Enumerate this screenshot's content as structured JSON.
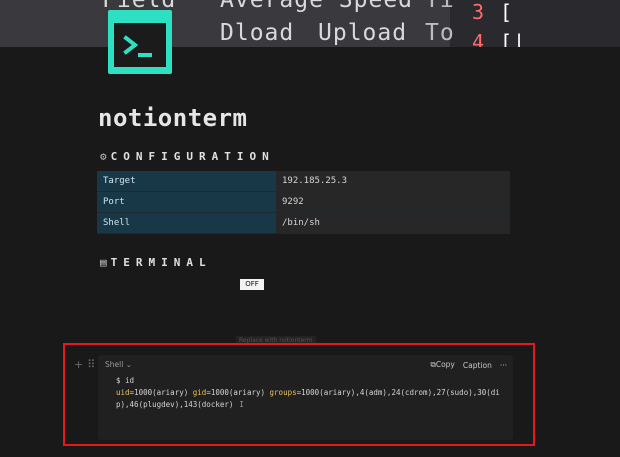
{
  "cover": {
    "line1": [
      "Field",
      "Average Speed",
      "Ti"
    ],
    "line2": [
      "Dload",
      "Upload",
      "To"
    ],
    "side_rows": [
      {
        "num": "3",
        "bracket": "["
      },
      {
        "num": "4",
        "bracket": "[|"
      }
    ]
  },
  "page": {
    "title": "notionterm"
  },
  "configuration": {
    "heading": "CONFIGURATION",
    "rows": [
      {
        "key": "Target",
        "value": "192.185.25.3"
      },
      {
        "key": "Port",
        "value": "9292"
      },
      {
        "key": "Shell",
        "value": "/bin/sh"
      }
    ]
  },
  "terminal": {
    "heading": "TERMINAL",
    "toggle_label": "OFF",
    "faded_label": "Replace with notionterm",
    "code_block": {
      "language": "Shell",
      "copy_label": "Copy",
      "caption_label": "Caption",
      "more_label": "···",
      "command": "$ id",
      "output": {
        "uid_key": "uid",
        "uid_val": "1000(ariary)",
        "gid_key": "gid",
        "gid_val": "1000(ariary)",
        "groups_key": "groups",
        "groups_val": "1000(ariary),4(adm),24(cdrom),27(sudo),30(dip),46(plugdev),143(docker)"
      }
    }
  },
  "colors": {
    "accent": "#2de0c1",
    "highlight_border": "#e3191b",
    "table_key_bg": "#183848"
  }
}
